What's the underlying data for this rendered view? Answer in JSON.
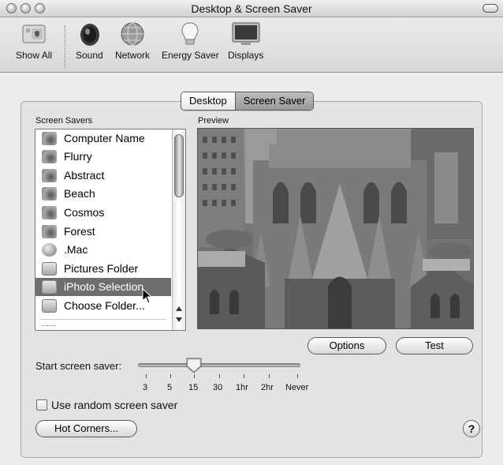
{
  "window": {
    "title": "Desktop & Screen Saver"
  },
  "toolbar": {
    "items": [
      {
        "label": "Show All",
        "icon": "show-all-icon"
      },
      {
        "label": "Sound",
        "icon": "speaker-icon"
      },
      {
        "label": "Network",
        "icon": "network-globe-icon"
      },
      {
        "label": "Energy Saver",
        "icon": "lightbulb-icon"
      },
      {
        "label": "Displays",
        "icon": "display-monitor-icon"
      }
    ]
  },
  "tabs": [
    {
      "label": "Desktop",
      "selected": false
    },
    {
      "label": "Screen Saver",
      "selected": true
    }
  ],
  "screen_savers": {
    "label": "Screen Savers",
    "items": [
      {
        "label": "Computer Name",
        "icon": "screensaver-swirl-icon"
      },
      {
        "label": "Flurry",
        "icon": "screensaver-swirl-icon"
      },
      {
        "label": "Abstract",
        "icon": "screensaver-swirl-icon"
      },
      {
        "label": "Beach",
        "icon": "screensaver-swirl-icon"
      },
      {
        "label": "Cosmos",
        "icon": "screensaver-swirl-icon"
      },
      {
        "label": "Forest",
        "icon": "screensaver-swirl-icon"
      },
      {
        "label": ".Mac",
        "icon": "dotmac-globe-icon"
      },
      {
        "label": "Pictures Folder",
        "icon": "folder-icon"
      },
      {
        "label": "iPhoto Selection",
        "icon": "folder-icon",
        "selected": true
      },
      {
        "label": "Choose Folder...",
        "icon": "folder-icon"
      }
    ]
  },
  "preview": {
    "label": "Preview"
  },
  "buttons": {
    "options": "Options",
    "test": "Test",
    "hot_corners": "Hot Corners..."
  },
  "start": {
    "label": "Start screen saver:",
    "ticks": [
      "3",
      "5",
      "15",
      "30",
      "1hr",
      "2hr",
      "Never"
    ],
    "selected": "15"
  },
  "random": {
    "label": "Use random screen saver",
    "checked": false
  },
  "help": {
    "label": "?"
  },
  "colors": {
    "selection": "#6e6e6e",
    "window_bg": "#ececec"
  }
}
